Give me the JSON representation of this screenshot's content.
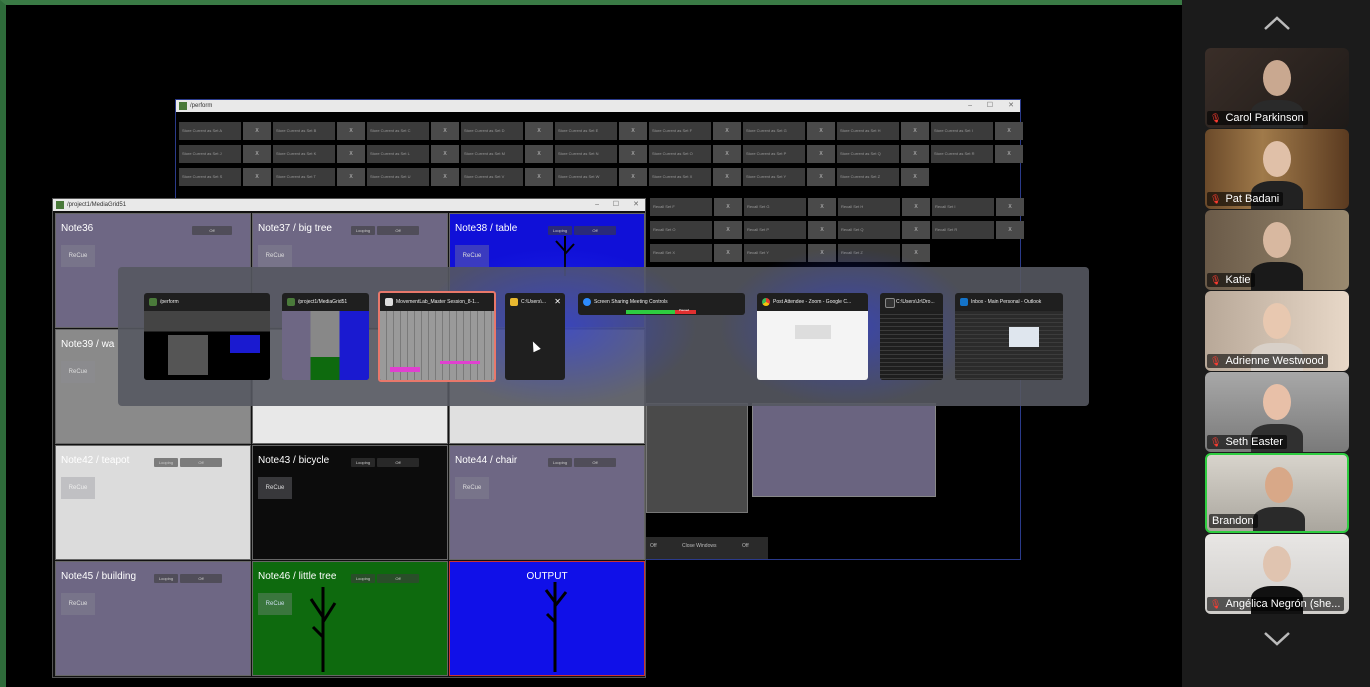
{
  "share": {
    "perform_window": {
      "title": "/perform",
      "store_rows": [
        [
          "Store Current as Set A",
          "Store Current as Set B",
          "Store Current as Set C",
          "Store Current as Set D",
          "Store Current as Set E",
          "Store Current as Set F",
          "Store Current as Set G",
          "Store Current as Set H",
          "Store Current as Set I"
        ],
        [
          "Store Current as Set J",
          "Store Current as Set K",
          "Store Current as Set L",
          "Store Current as Set M",
          "Store Current as Set N",
          "Store Current as Set O",
          "Store Current as Set P",
          "Store Current as Set Q",
          "Store Current as Set R"
        ],
        [
          "Store Current as Set S",
          "Store Current as Set T",
          "Store Current as Set U",
          "Store Current as Set V",
          "Store Current as Set W",
          "Store Current as Set X",
          "Store Current as Set Y",
          "Store Current as Set Z"
        ]
      ],
      "recall_rows": [
        [
          "Recall Set F",
          "Recall Set G",
          "Recall Set H",
          "Recall Set I"
        ],
        [
          "Recall Set O",
          "Recall Set P",
          "Recall Set Q",
          "Recall Set R"
        ],
        [
          "Recall Set X",
          "Recall Set Y",
          "Recall Set Z"
        ]
      ],
      "x_label": "X",
      "bottom_buttons": [
        "Off",
        "Close Windows",
        "Off"
      ]
    },
    "media_window": {
      "title": "/project1/MediaGrid51",
      "recue_label": "ReCue",
      "tiles": [
        {
          "label": "Note36"
        },
        {
          "label": "Note37 / big tree"
        },
        {
          "label": "Note38 / table"
        },
        {
          "label": "Note39 / wa"
        },
        {
          "label": "Note42 / teapot"
        },
        {
          "label": "Note43 / bicycle"
        },
        {
          "label": "Note44 / chair"
        },
        {
          "label": "Note45 / building"
        },
        {
          "label": "Note46 / little tree"
        },
        {
          "label": "OUTPUT"
        }
      ],
      "pill_left": "Looping",
      "pill_right": "Off"
    },
    "switcher": {
      "items": [
        {
          "title": "/perform"
        },
        {
          "title": "/project1/MediaGrid51"
        },
        {
          "title": "MovementLab_Master Session_8-1..."
        },
        {
          "title": "C:\\Users\\..."
        },
        {
          "title": "Screen Sharing Meeting Controls"
        },
        {
          "title": "Post Attendee - Zoom - Google C..."
        },
        {
          "title": "C:\\Users\\Jr\\Dro..."
        },
        {
          "title": "Inbox - Main Personal - Outlook"
        }
      ],
      "close_glyph": "✕",
      "meeting_paused": "Paused"
    }
  },
  "participants": [
    {
      "name": "Carol Parkinson",
      "muted": true
    },
    {
      "name": "Pat Badani",
      "muted": true
    },
    {
      "name": "Katie",
      "muted": true
    },
    {
      "name": "Adrienne Westwood",
      "muted": true
    },
    {
      "name": "Seth Easter",
      "muted": true
    },
    {
      "name": "Brandon",
      "muted": false,
      "active_speaker": true
    },
    {
      "name": "Angélica Negrón (she...",
      "muted": true
    }
  ],
  "icons": {
    "scroll_up": "chevron-up-icon",
    "scroll_down": "chevron-down-icon",
    "muted_mic": "muted-mic-icon"
  },
  "colors": {
    "active_speaker_border": "#2ecc40",
    "switcher_selected_border": "#e8786b",
    "share_border": "#3a7a45",
    "muted_mic": "#ff3b30"
  }
}
